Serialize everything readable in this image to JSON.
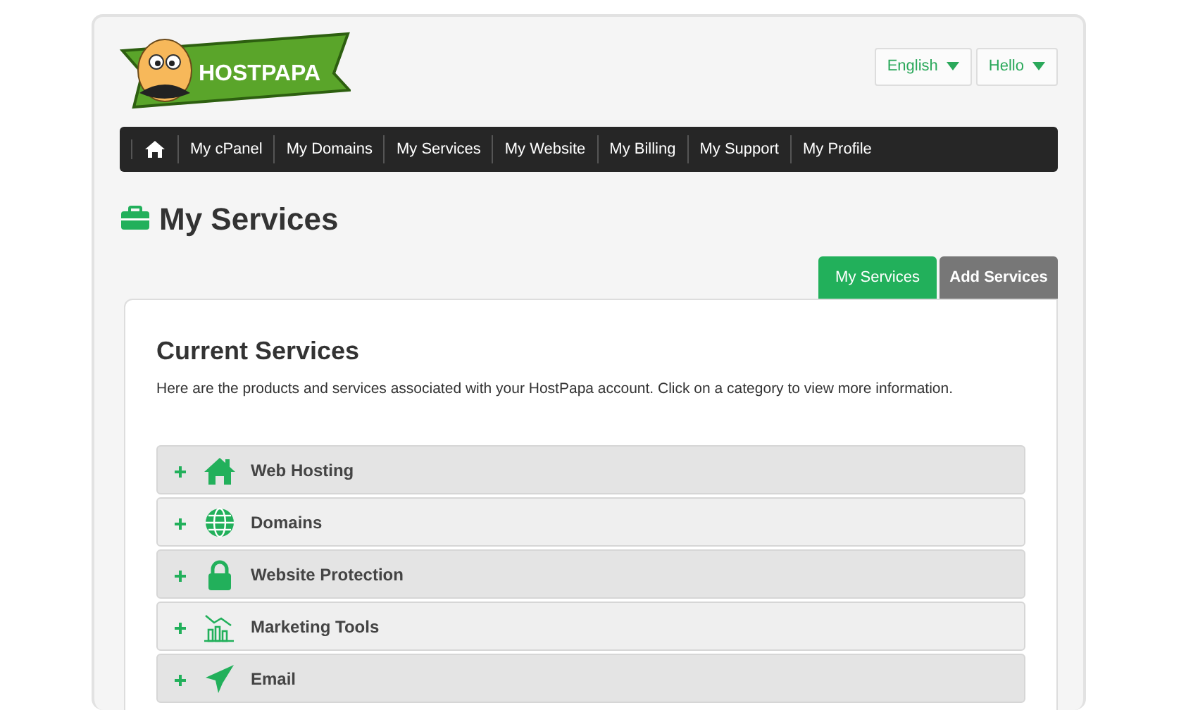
{
  "logo": {
    "text": "HOSTPAPA"
  },
  "header_menus": [
    {
      "label": "English"
    },
    {
      "label": "Hello"
    }
  ],
  "nav": {
    "items": [
      "My cPanel",
      "My Domains",
      "My Services",
      "My Website",
      "My Billing",
      "My Support",
      "My Profile"
    ]
  },
  "page_title": "My Services",
  "tabs": [
    {
      "label": "My Services",
      "selected": true
    },
    {
      "label": "Add Services",
      "selected": false
    }
  ],
  "section": {
    "title": "Current Services",
    "description": "Here are the products and services associated with your HostPapa account. Click on a category to view more information."
  },
  "categories": [
    {
      "label": "Web Hosting",
      "expanded": false
    },
    {
      "label": "Domains",
      "expanded": false
    },
    {
      "label": "Website Protection",
      "expanded": false
    },
    {
      "label": "Marketing Tools",
      "expanded": false
    },
    {
      "label": "Email",
      "expanded": false
    }
  ]
}
